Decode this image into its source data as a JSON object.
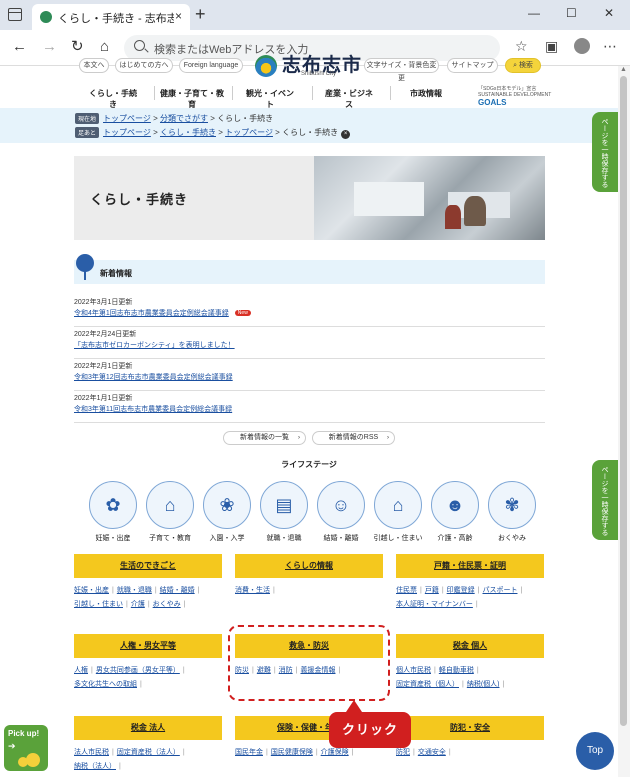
{
  "browser": {
    "tab_title": "くらし・手続き - 志布志市公式ホーム",
    "tab_close": "×",
    "new_tab": "+",
    "address_placeholder": "検索またはWebアドレスを入力",
    "nav": {
      "back": "←",
      "forward": "→",
      "reload": "↻",
      "home": "⌂"
    },
    "window_controls": {
      "minimize": "—",
      "maximize": "☐",
      "close": "✕"
    },
    "tools": {
      "favorites": "☆",
      "collections": "▣",
      "menu": "⋯"
    }
  },
  "header": {
    "utility_links": [
      "本文へ",
      "はじめての方へ",
      "Foreign language"
    ],
    "logo_name": "志布志市",
    "logo_sub": "Shibushi City",
    "tools": [
      "文字サイズ・背景色変更",
      "サイトマップ"
    ],
    "search_label": "検索",
    "search_icon": "magnifier-icon",
    "sdgs": {
      "top": "「SDGs日本モデル」宣言",
      "main": "GOALS",
      "left": "SUSTAINABLE DEVELOPMENT"
    }
  },
  "global_nav": [
    "くらし・手続き",
    "健康・子育て・教育",
    "観光・イベント",
    "産業・ビジネス",
    "市政情報"
  ],
  "breadcrumbs": {
    "current": {
      "tag": "現在地",
      "items": [
        "トップページ",
        "分類でさがす",
        "くらし・手続き"
      ]
    },
    "path": {
      "tag": "足あと",
      "items": [
        "トップページ",
        "くらし・手続き",
        "トップページ",
        "くらし・手続き"
      ],
      "close": "×"
    }
  },
  "hero": {
    "title": "くらし・手続き"
  },
  "news": {
    "title": "新着情報",
    "items": [
      {
        "date": "2022年3月1日更新",
        "title": "令和4年第1回志布志市農業委員会定例総会議事録",
        "badge": "New"
      },
      {
        "date": "2022年2月24日更新",
        "title": "「志布志市ゼロカーボンシティ」を表明しました！",
        "badge": ""
      },
      {
        "date": "2022年2月1日更新",
        "title": "令和3年第12回志布志市農業委員会定例総会議事録",
        "badge": ""
      },
      {
        "date": "2022年1月1日更新",
        "title": "令和3年第11回志布志市農業委員会定例総会議事録",
        "badge": ""
      }
    ],
    "buttons": [
      "新着情報の一覧",
      "新着情報のRSS"
    ],
    "button_arrow": "›"
  },
  "life_stage": {
    "heading": "ライフステージ",
    "items": [
      {
        "label": "妊娠・出産",
        "icon": "pregnancy-icon",
        "glyph": "✿"
      },
      {
        "label": "子育て・教育",
        "icon": "school-icon",
        "glyph": "⌂"
      },
      {
        "label": "入園・入学",
        "icon": "flower-icon",
        "glyph": "❀"
      },
      {
        "label": "就職・退職",
        "icon": "briefcase-icon",
        "glyph": "▤"
      },
      {
        "label": "結婚・離婚",
        "icon": "couple-icon",
        "glyph": "☺"
      },
      {
        "label": "引越し・住まい",
        "icon": "house-icon",
        "glyph": "⌂"
      },
      {
        "label": "介護・高齢",
        "icon": "elderly-icon",
        "glyph": "☻"
      },
      {
        "label": "おくやみ",
        "icon": "bouquet-icon",
        "glyph": "✾"
      }
    ]
  },
  "categories": [
    {
      "title": "生活のできごと",
      "links": [
        "妊娠・出産",
        "就職・退職",
        "結婚・離婚",
        "引越し・住まい",
        "介護",
        "おくやみ"
      ]
    },
    {
      "title": "くらしの情報",
      "links": [
        "消費・生活"
      ]
    },
    {
      "title": "戸籍・住民票・証明",
      "links": [
        "住民票",
        "戸籍",
        "印鑑登録",
        "パスポート",
        "本人証明・マイナンバー"
      ]
    },
    {
      "title": "人権・男女平等",
      "links": [
        "人権",
        "男女共同参画（男女平等）",
        "多文化共生への取組"
      ]
    },
    {
      "title": "救急・防災",
      "links": [
        "防災",
        "避難",
        "消防",
        "義援金情報"
      ]
    },
    {
      "title": "税金 個人",
      "links": [
        "個人市民税",
        "軽自動車税",
        "固定資産税（個人）",
        "納税(個人)"
      ]
    },
    {
      "title": "税金 法人",
      "links": [
        "法人市民税",
        "固定資産税（法人）",
        "納税（法人）"
      ]
    },
    {
      "title": "保険・保健・年金",
      "links": [
        "国民年金",
        "国民健康保険",
        "介護保険"
      ]
    },
    {
      "title": "防犯・安全",
      "links": [
        "防犯",
        "交通安全"
      ]
    }
  ],
  "annotation": {
    "label": "クリック",
    "color": "#d11f1f"
  },
  "side_tab": "ページを一時保存する",
  "pickup": {
    "label": "Pick up!",
    "arrow": "➔"
  },
  "top_button": "Top",
  "colors": {
    "accent_yellow": "#f4c81e",
    "link_blue": "#1a4fa0",
    "annotation_red": "#d11f1f",
    "band_blue": "#e6f3fb",
    "side_green": "#5aa23a"
  }
}
